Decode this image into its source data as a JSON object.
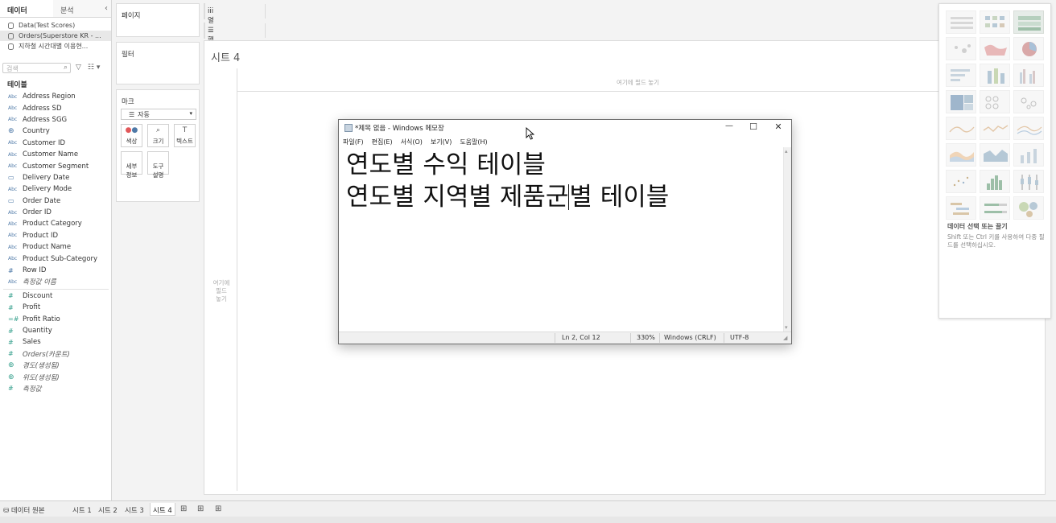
{
  "left_pane": {
    "tabs": [
      "데이터",
      "분석"
    ],
    "collapse_glyph": "‹",
    "datasources": [
      "Data(Test Scores)",
      "Orders(Superstore KR - ...",
      "지하철 시간대별 이용현..."
    ],
    "search_placeholder": "검색",
    "tables_header": "테이블",
    "dimensions": [
      {
        "type": "Abc",
        "name": "Address Region"
      },
      {
        "type": "Abc",
        "name": "Address SD"
      },
      {
        "type": "Abc",
        "name": "Address SGG"
      },
      {
        "type": "geo",
        "name": "Country"
      },
      {
        "type": "Abc",
        "name": "Customer ID"
      },
      {
        "type": "Abc",
        "name": "Customer Name"
      },
      {
        "type": "Abc",
        "name": "Customer Segment"
      },
      {
        "type": "date",
        "name": "Delivery Date"
      },
      {
        "type": "Abc",
        "name": "Delivery Mode"
      },
      {
        "type": "date",
        "name": "Order Date"
      },
      {
        "type": "Abc",
        "name": "Order ID"
      },
      {
        "type": "Abc",
        "name": "Product Category"
      },
      {
        "type": "Abc",
        "name": "Product ID"
      },
      {
        "type": "Abc",
        "name": "Product Name"
      },
      {
        "type": "Abc",
        "name": "Product Sub-Category"
      },
      {
        "type": "#",
        "name": "Row ID"
      },
      {
        "type": "Abc",
        "name": "측정값 이름",
        "italic": true
      }
    ],
    "measures": [
      {
        "type": "#",
        "name": "Discount"
      },
      {
        "type": "#",
        "name": "Profit"
      },
      {
        "type": "=#",
        "name": "Profit Ratio"
      },
      {
        "type": "#",
        "name": "Quantity"
      },
      {
        "type": "#",
        "name": "Sales"
      },
      {
        "type": "#",
        "name": "Orders(카운트)",
        "italic": true
      },
      {
        "type": "geo",
        "name": "경도(생성됨)",
        "italic": true
      },
      {
        "type": "geo",
        "name": "위도(생성됨)",
        "italic": true
      },
      {
        "type": "#",
        "name": "측정값",
        "italic": true
      }
    ]
  },
  "shelves": {
    "pages": "페이지",
    "filters": "필터",
    "marks": "마크",
    "marks_type": "자동",
    "mark_buttons": [
      "색상",
      "크기",
      "텍스트",
      "세부\n정보",
      "도구\n설명"
    ],
    "columns_label": "열",
    "rows_label": "행"
  },
  "sheet": {
    "title": "시트 4",
    "drop_col_hint": "여기에 필드 놓기",
    "drop_row_hint": "여기에\n필드\n놓기"
  },
  "show_me": {
    "title": "데이터 선택 또는 끌기",
    "text": "Shift 또는 Ctrl 키를 사용하여 다중 필드를 선택하십시오."
  },
  "notepad": {
    "title": "*제목 없음 - Windows 메모장",
    "menu": [
      "파일(F)",
      "편집(E)",
      "서식(O)",
      "보기(V)",
      "도움말(H)"
    ],
    "line1": "연도별 수익 테이블",
    "line2_before_cursor": "연도별 지역별 제품군",
    "line2_after_cursor": "별 테이블",
    "status_position": "Ln 2, Col 12",
    "status_zoom": "330%",
    "status_eol": "Windows (CRLF)",
    "status_encoding": "UTF-8"
  },
  "tabs": {
    "datasource": "데이터 원본",
    "sheets": [
      "시트 1",
      "시트 2",
      "시트 3",
      "시트 4"
    ],
    "active": "시트 4"
  },
  "colors": {
    "dimension_icon": "#4e79a7",
    "measure_icon": "#3aa28f",
    "accent": "#1f77b4"
  }
}
